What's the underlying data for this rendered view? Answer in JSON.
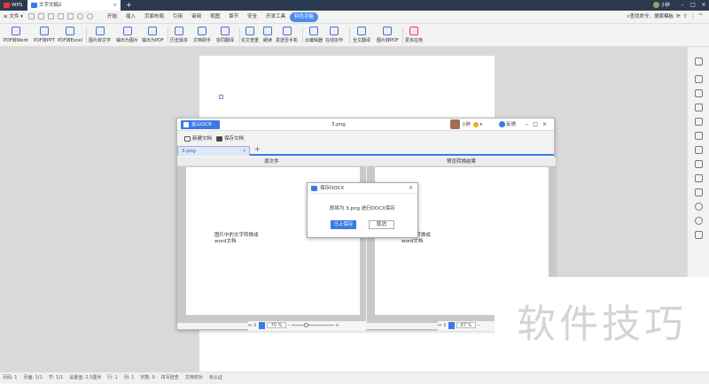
{
  "titlebar": {
    "tabs": [
      {
        "label": "WPS"
      },
      {
        "label": "文字文稿2"
      }
    ],
    "user": "小胖"
  },
  "menubar": {
    "file": "≡ 文件 ▾",
    "items": [
      "开始",
      "插入",
      "页面布局",
      "引用",
      "审阅",
      "视图",
      "章节",
      "安全",
      "开发工具",
      "特色功能"
    ],
    "active_index": 9,
    "search": "查找命令、搜索模板"
  },
  "ribbon": {
    "buttons": [
      "PDF转Word",
      "PDF转PPT",
      "PDF转Excel",
      "图片转文字",
      "输出为图片",
      "输出为PDF",
      "历史版本",
      "文档助手",
      "协同翻译",
      "论文查重",
      "朗读",
      "发送至手机",
      "云编辑器",
      "在线协作",
      "全文翻译",
      "图片转PDF",
      "更多应用"
    ]
  },
  "ocr_window": {
    "app_name": "金山OCR文字识别",
    "file_title": "3.png",
    "user": "小胖",
    "feedback": "反馈",
    "toolbar": {
      "new": "新建文档",
      "save": "保存文档"
    },
    "file_tab": "3.png",
    "left_pane": {
      "header": "原文件",
      "text": [
        "图片中的文字转换成",
        "word文档"
      ],
      "zoom": "70 %"
    },
    "right_pane": {
      "header": "预览转换结果",
      "text": [
        "的文字转换成",
        "word文档"
      ],
      "zoom": "87 %"
    }
  },
  "dialog": {
    "title": "保存DOCX",
    "message": "即将为 3.png 进行DOCX保存",
    "ok": "马上保存",
    "cancel": "取消"
  },
  "statusbar": {
    "items": [
      "页码: 1",
      "页面: 1/1",
      "节: 1/1",
      "设置值: 2.5厘米",
      "行: 1",
      "列: 1",
      "字数: 0",
      "拼写检查",
      "文档校对",
      "未认证"
    ]
  },
  "watermark": "软件技巧"
}
